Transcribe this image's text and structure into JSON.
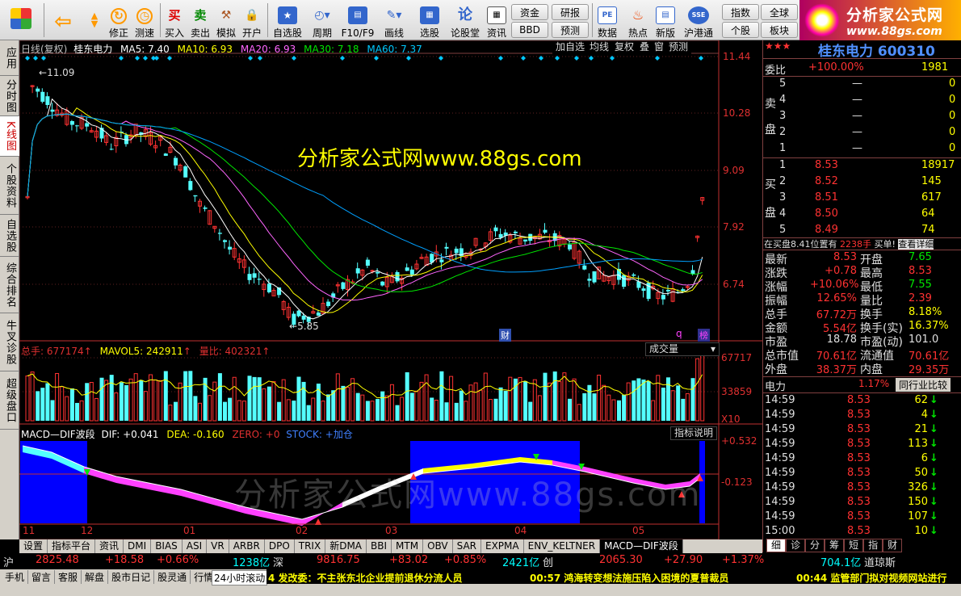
{
  "toolbar": {
    "buttons": [
      "修正",
      "测速",
      "买入",
      "卖出",
      "模拟",
      "开户",
      "自选股",
      "周期",
      "F10/F9",
      "画线",
      "选股",
      "论股堂",
      "资讯",
      "数据",
      "热点",
      "新版",
      "沪港通"
    ],
    "small": [
      "资金",
      "研报",
      "指数",
      "全球",
      "BBD",
      "预测",
      "个股",
      "板块"
    ]
  },
  "logo": {
    "title": "分析家公式网",
    "url": "www.88gs.com"
  },
  "left_tabs": [
    "应用",
    "分时图",
    "K线图",
    "个股资料",
    "自选股",
    "综合排名",
    "牛叉诊股",
    "超级盘口"
  ],
  "chart": {
    "header": {
      "period": "日线(复权)",
      "name": "桂东电力",
      "ma5": "MA5: 7.40",
      "ma10": "MA10: 6.93",
      "ma20": "MA20: 6.93",
      "ma30": "MA30: 7.18",
      "ma60": "MA60: 7.37"
    },
    "buttons": [
      "加自选",
      "均线",
      "复权",
      "叠",
      "窗",
      "预测"
    ],
    "y_axis": [
      "11.44",
      "10.28",
      "9.09",
      "7.92",
      "6.74"
    ],
    "high_label": "11.09",
    "low_label": "5.85",
    "markers": {
      "cai": "财",
      "q": "q",
      "tie": "榜"
    },
    "watermark1": "分析家公式网www.88gs.com",
    "watermark2": "分析家公式网www.88gs.com",
    "vol_header": {
      "total": "总手: 677174",
      "mavol": "MAVOL5: 242911",
      "ratio": "量比: 402321"
    },
    "vol_select": "成交量",
    "vol_axis": [
      "67717",
      "33859",
      "X10"
    ],
    "macd_header": {
      "title": "MACD—DIF波段",
      "dif": "DIF: +0.041",
      "dea": "DEA: -0.160",
      "zero": "ZERO: +0",
      "stock": "STOCK: +加仓"
    },
    "macd_button": "指标说明",
    "macd_axis": [
      "+0.532",
      "-0.123"
    ],
    "x_axis": [
      "11",
      "12",
      "01",
      "02",
      "03",
      "04",
      "05"
    ]
  },
  "bottom_tabs": [
    "设置",
    "指标平台",
    "资讯",
    "DMI",
    "BIAS",
    "ASI",
    "VR",
    "ARBR",
    "DPO",
    "TRIX",
    "新DMA",
    "BBI",
    "MTM",
    "OBV",
    "SAR",
    "EXPMA",
    "ENV_KELTNER",
    "MACD—DIF波段"
  ],
  "right": {
    "title": "桂东电力 600310",
    "weibi_label": "委比",
    "weibi": "+100.00%",
    "weicha": "1981",
    "sell_label": [
      "卖",
      "盘"
    ],
    "sells": [
      {
        "n": "5",
        "p": "—",
        "v": ""
      },
      {
        "n": "4",
        "p": "—",
        "v": ""
      },
      {
        "n": "3",
        "p": "—",
        "v": ""
      },
      {
        "n": "2",
        "p": "—",
        "v": ""
      },
      {
        "n": "1",
        "p": "—",
        "v": ""
      }
    ],
    "buy_label": [
      "买",
      "盘"
    ],
    "buys": [
      {
        "n": "1",
        "p": "8.53",
        "v": "18917"
      },
      {
        "n": "2",
        "p": "8.52",
        "v": "145"
      },
      {
        "n": "3",
        "p": "8.51",
        "v": "617"
      },
      {
        "n": "4",
        "p": "8.50",
        "v": "64"
      },
      {
        "n": "5",
        "p": "8.49",
        "v": "74"
      }
    ],
    "buy_note": "在买盘8.41位置有",
    "buy_note2": "2238手",
    "buy_note3": "买单!",
    "buy_note4": "查看详细",
    "quote": [
      {
        "l": "最新",
        "v": "8.53",
        "l2": "开盘",
        "v2": "7.65"
      },
      {
        "l": "涨跌",
        "v": "+0.78",
        "l2": "最高",
        "v2": "8.53"
      },
      {
        "l": "涨幅",
        "v": "+10.06%",
        "l2": "最低",
        "v2": "7.55"
      },
      {
        "l": "振幅",
        "v": "12.65%",
        "l2": "量比",
        "v2": "2.39"
      },
      {
        "l": "总手",
        "v": "67.72万",
        "l2": "换手",
        "v2": "8.18%"
      },
      {
        "l": "金额",
        "v": "5.54亿",
        "l2": "换手(实)",
        "v2": "16.37%"
      },
      {
        "l": "市盈",
        "v": "18.78",
        "l2": "市盈(动)",
        "v2": "101.0"
      },
      {
        "l": "总市值",
        "v": "70.61亿",
        "l2": "流通值",
        "v2": "70.61亿"
      },
      {
        "l": "外盘",
        "v": "38.37万",
        "l2": "内盘",
        "v2": "29.35万"
      }
    ],
    "sector": "电力",
    "sector_pct": "1.17%",
    "sector_btn": "同行业比较",
    "ticks": [
      {
        "t": "14:59",
        "p": "8.53",
        "v": "62"
      },
      {
        "t": "14:59",
        "p": "8.53",
        "v": "4"
      },
      {
        "t": "14:59",
        "p": "8.53",
        "v": "21"
      },
      {
        "t": "14:59",
        "p": "8.53",
        "v": "113"
      },
      {
        "t": "14:59",
        "p": "8.53",
        "v": "6"
      },
      {
        "t": "14:59",
        "p": "8.53",
        "v": "50"
      },
      {
        "t": "14:59",
        "p": "8.53",
        "v": "326"
      },
      {
        "t": "14:59",
        "p": "8.53",
        "v": "150"
      },
      {
        "t": "14:59",
        "p": "8.53",
        "v": "107"
      },
      {
        "t": "15:00",
        "p": "8.53",
        "v": "10"
      }
    ],
    "tabs": [
      "细",
      "诊",
      "分",
      "筹",
      "短",
      "指",
      "财"
    ]
  },
  "index_bar": {
    "sh": "沪",
    "sh_v": "2825.48",
    "sh_c": "+18.58",
    "sh_p": "+0.66%",
    "sh_a": "1238亿",
    "sz": "深",
    "sz_v": "9816.75",
    "sz_c": "+83.02",
    "sz_p": "+0.85%",
    "sz_a": "2421亿",
    "cy": "创",
    "cy_v": "2065.30",
    "cy_c": "+27.90",
    "cy_p": "+1.37%",
    "cy_a": "704.1亿",
    "dj": "道琼斯"
  },
  "status": {
    "items": [
      "手机",
      "留言",
      "客服",
      "解盘",
      "股市日记",
      "股灵通",
      "行情"
    ],
    "live": "24小时滚动",
    "news1": "4 发改委：不主张东北企业提前退休分流人员",
    "news2": "00:57 鸿海转变想法施压陷入困境的夏普裁员",
    "news3": "00:44 监管部门拟对视频网站进行"
  }
}
